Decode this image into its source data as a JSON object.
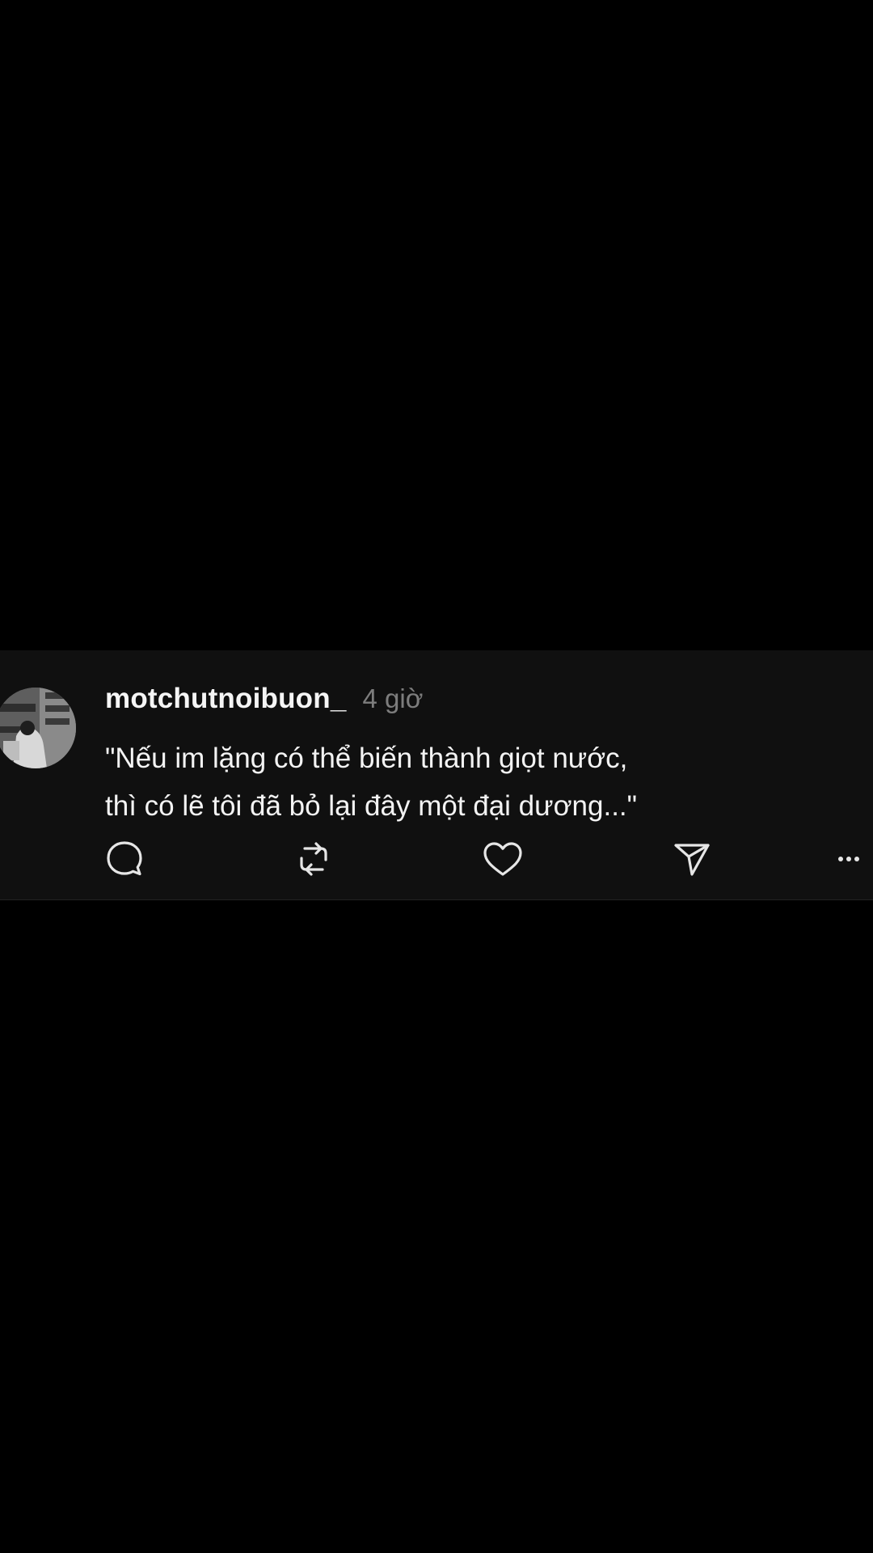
{
  "post": {
    "username": "motchutnoibuon_",
    "timestamp": "4 giờ",
    "text_lines": [
      "\"Nếu im lặng có thể biến thành giọt nước,",
      "thì có lẽ tôi đã bỏ lại đây một đại dương...\""
    ]
  },
  "actions": {
    "reply_icon": "speech-bubble-icon",
    "repost_icon": "repost-arrows-icon",
    "like_icon": "heart-icon",
    "share_icon": "paper-plane-icon",
    "more_icon": "ellipsis-icon"
  },
  "colors": {
    "background": "#000000",
    "card": "#101010",
    "text_primary": "#f3f3f3",
    "text_secondary": "#7d7d7d",
    "icon": "#e6e6e6"
  }
}
